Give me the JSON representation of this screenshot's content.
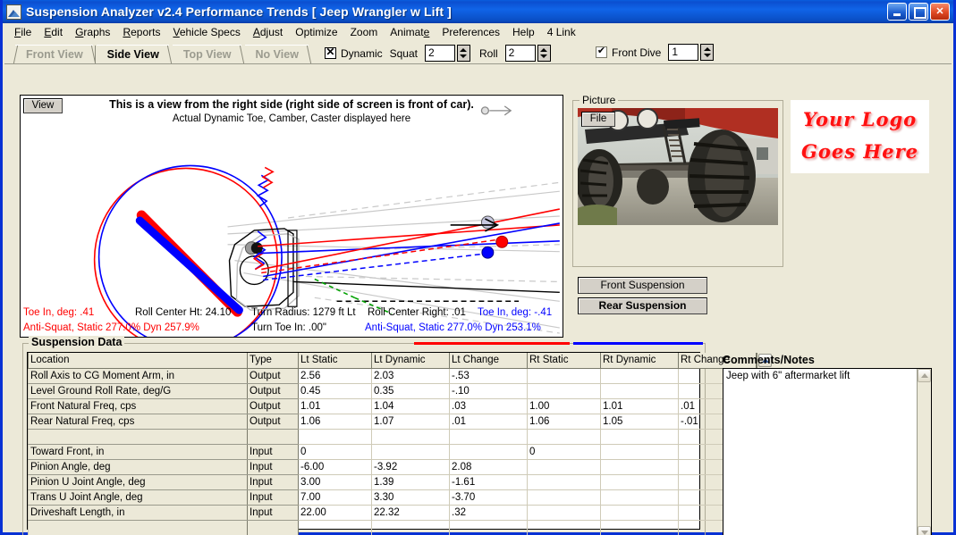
{
  "window": {
    "title": "Suspension Analyzer v2.4   Performance Trends   [ Jeep Wrangler w Lift ]",
    "icon": "suspension-app-icon",
    "minimize_label": "",
    "maximize_label": "",
    "close_label": "✕"
  },
  "menu": {
    "items": [
      {
        "label": "File"
      },
      {
        "label": "Edit"
      },
      {
        "label": "Graphs"
      },
      {
        "label": "Reports"
      },
      {
        "label": "Vehicle Specs"
      },
      {
        "label": "Adjust"
      },
      {
        "label": "Optimize"
      },
      {
        "label": "Zoom"
      },
      {
        "label": "Animate"
      },
      {
        "label": "Preferences"
      },
      {
        "label": "Help"
      },
      {
        "label": "4 Link"
      }
    ]
  },
  "tabs": [
    {
      "label": "Front View",
      "active": false
    },
    {
      "label": "Side View",
      "active": true
    },
    {
      "label": "Top View",
      "active": false
    },
    {
      "label": "No View",
      "active": false
    }
  ],
  "toolbar": {
    "dynamic_label": "Dynamic",
    "dynamic_checked": "X",
    "squat_label": "Squat",
    "squat_value": "2",
    "roll_label": "Roll",
    "roll_value": "2",
    "front_dive_label": "Front Dive",
    "front_dive_checked": "✔",
    "front_dive_value": "1"
  },
  "drawing": {
    "view_button": "View",
    "title": "This is a view from the right side (right side of screen is front of car).",
    "subtitle": "Actual Dynamic Toe, Camber, Caster displayed here"
  },
  "readout": {
    "left_toe": "Toe In, deg: .41",
    "roll_center_ht": "Roll Center Ht: 24.10",
    "turn_radius": "Turn Radius: 1279 ft Lt",
    "roll_center_right": "Roll Center Right: .01",
    "right_toe": "Toe In, deg: -.41",
    "left_antisquat": "Anti-Squat, Static 277.0%   Dyn 257.9%",
    "turn_toe_in": "Turn Toe In: .00\"",
    "right_antisquat": "Anti-Squat, Static 277.0%   Dyn 253.1%"
  },
  "picture": {
    "group_label": "Picture",
    "file_button": "File",
    "photo_alt": "jeep-suspension-photo"
  },
  "logo": {
    "line1": "Your Logo",
    "line2": "Goes Here",
    "color": "#ff1111"
  },
  "buttons": {
    "front_suspension": "Front Suspension",
    "rear_suspension": "Rear Suspension"
  },
  "data_group": {
    "label": "Suspension Data",
    "legend_left_color": "#ff0000",
    "legend_right_color": "#0000ff",
    "columns": [
      "Location",
      "Type",
      "Lt Static",
      "Lt Dynamic",
      "Lt Change",
      "Rt Static",
      "Rt Dynamic",
      "Rt Change"
    ],
    "rows": [
      {
        "location": "Roll Axis to CG Moment Arm, in",
        "type": "Output",
        "lt_static": "2.56",
        "lt_dynamic": "2.03",
        "lt_change": "-.53",
        "rt_static": "",
        "rt_dynamic": "",
        "rt_change": ""
      },
      {
        "location": "Level Ground Roll Rate, deg/G",
        "type": "Output",
        "lt_static": "0.45",
        "lt_dynamic": "0.35",
        "lt_change": "-.10",
        "rt_static": "",
        "rt_dynamic": "",
        "rt_change": ""
      },
      {
        "location": "Front Natural Freq, cps",
        "type": "Output",
        "lt_static": "1.01",
        "lt_dynamic": "1.04",
        "lt_change": ".03",
        "rt_static": "1.00",
        "rt_dynamic": "1.01",
        "rt_change": ".01"
      },
      {
        "location": "Rear Natural Freq, cps",
        "type": "Output",
        "lt_static": "1.06",
        "lt_dynamic": "1.07",
        "lt_change": ".01",
        "rt_static": "1.06",
        "rt_dynamic": "1.05",
        "rt_change": "-.01"
      },
      {
        "location": "",
        "type": "",
        "lt_static": "",
        "lt_dynamic": "",
        "lt_change": "",
        "rt_static": "",
        "rt_dynamic": "",
        "rt_change": ""
      },
      {
        "location": "Toward Front, in",
        "type": "Input",
        "lt_static": "0",
        "lt_dynamic": "",
        "lt_change": "",
        "rt_static": "0",
        "rt_dynamic": "",
        "rt_change": ""
      },
      {
        "location": "Pinion Angle, deg",
        "type": "Input",
        "lt_static": "-6.00",
        "lt_dynamic": "-3.92",
        "lt_change": "2.08",
        "rt_static": "",
        "rt_dynamic": "",
        "rt_change": ""
      },
      {
        "location": "Pinion U Joint Angle, deg",
        "type": "Input",
        "lt_static": "3.00",
        "lt_dynamic": "1.39",
        "lt_change": "-1.61",
        "rt_static": "",
        "rt_dynamic": "",
        "rt_change": ""
      },
      {
        "location": "Trans U Joint Angle, deg",
        "type": "Input",
        "lt_static": "7.00",
        "lt_dynamic": "3.30",
        "lt_change": "-3.70",
        "rt_static": "",
        "rt_dynamic": "",
        "rt_change": ""
      },
      {
        "location": "Driveshaft Length, in",
        "type": "Input",
        "lt_static": "22.00",
        "lt_dynamic": "22.32",
        "lt_change": ".32",
        "rt_static": "",
        "rt_dynamic": "",
        "rt_change": ""
      },
      {
        "location": "",
        "type": "",
        "lt_static": "",
        "lt_dynamic": "",
        "lt_change": "",
        "rt_static": "",
        "rt_dynamic": "",
        "rt_change": ""
      }
    ]
  },
  "comments": {
    "label": "Comments/Notes",
    "text": "Jeep with 6\" aftermarket lift"
  }
}
